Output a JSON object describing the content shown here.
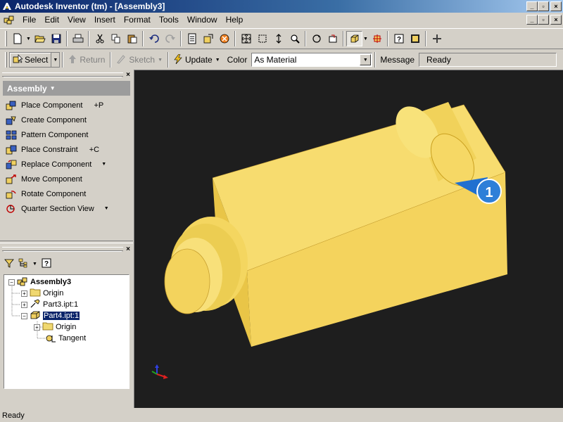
{
  "window": {
    "title": "Autodesk Inventor (tm) - [Assembly3]"
  },
  "menu": {
    "items": [
      "File",
      "Edit",
      "View",
      "Insert",
      "Format",
      "Tools",
      "Window",
      "Help"
    ]
  },
  "toolbar1": {
    "icons": [
      "new-icon",
      "open-icon",
      "save-icon",
      "print-icon",
      "cut-icon",
      "copy-icon",
      "paste-icon",
      "undo-icon",
      "redo-icon",
      "zoom-all-icon",
      "zoom-window-icon",
      "pan-icon",
      "zoom-icon",
      "rotate-icon",
      "look-at-icon",
      "shaded-display-icon",
      "shadow-icon",
      "help-icon",
      "what-is-icon",
      "plus-icon"
    ]
  },
  "toolbar2": {
    "select_label": "Select",
    "return_label": "Return",
    "sketch_label": "Sketch",
    "update_label": "Update",
    "color_label": "Color",
    "color_value": "As Material",
    "message_label": "Message",
    "message_value": "Ready"
  },
  "panel_bar": {
    "header": "Assembly",
    "commands": [
      {
        "label": "Place Component",
        "shortcut": "+P",
        "icon": "place-component-icon"
      },
      {
        "label": "Create Component",
        "shortcut": "",
        "icon": "create-component-icon"
      },
      {
        "label": "Pattern Component",
        "shortcut": "",
        "icon": "pattern-component-icon"
      },
      {
        "label": "Place Constraint",
        "shortcut": "+C",
        "icon": "place-constraint-icon"
      },
      {
        "label": "Replace Component",
        "shortcut": "",
        "icon": "replace-component-icon"
      },
      {
        "label": "Move Component",
        "shortcut": "",
        "icon": "move-component-icon"
      },
      {
        "label": "Rotate Component",
        "shortcut": "",
        "icon": "rotate-component-icon"
      },
      {
        "label": "Quarter Section View",
        "shortcut": "",
        "icon": "section-view-icon"
      }
    ]
  },
  "browser": {
    "nodes": {
      "root": "Assembly3",
      "origin1": "Origin",
      "part3": "Part3.ipt:1",
      "part4": "Part4.ipt:1",
      "origin2": "Origin",
      "tangent": "Tangent"
    }
  },
  "viewport": {
    "background": "#1e1e1e",
    "part_color": "#f0d060",
    "marker_label": "1"
  },
  "status": {
    "text": "Ready"
  }
}
